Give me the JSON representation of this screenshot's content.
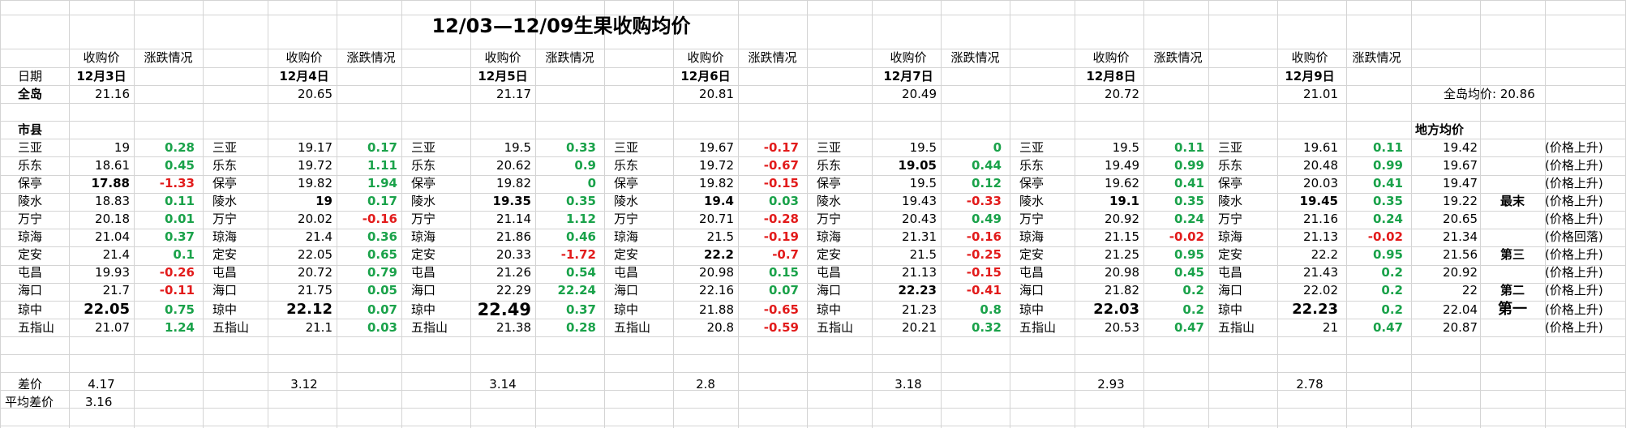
{
  "title": "12/03—12/09生果收购均价",
  "labels": {
    "date": "日期",
    "island": "全岛",
    "city_county": "市县",
    "spread": "差价",
    "avg_spread": "平均差价",
    "price_header": "收购价",
    "change_header": "涨跌情况",
    "island_avg": "全岛均价: 20.86",
    "local_avg": "地方均价"
  },
  "dates": [
    "12月3日",
    "12月4日",
    "12月5日",
    "12月6日",
    "12月7日",
    "12月8日",
    "12月9日"
  ],
  "island_prices": [
    "21.16",
    "20.65",
    "21.17",
    "20.81",
    "20.49",
    "20.72",
    "21.01"
  ],
  "spreads": [
    "4.17",
    "3.12",
    "3.14",
    "2.8",
    "3.18",
    "2.93",
    "2.78"
  ],
  "avg_spread": "3.16",
  "cities": [
    "三亚",
    "乐东",
    "保亭",
    "陵水",
    "万宁",
    "琼海",
    "定安",
    "屯昌",
    "海口",
    "琼中",
    "五指山"
  ],
  "days": [
    {
      "prices": [
        "19",
        "18.61",
        "17.88",
        "18.83",
        "20.18",
        "21.04",
        "21.4",
        "19.93",
        "21.7",
        "22.05",
        "21.07"
      ],
      "changes": [
        "0.28",
        "0.45",
        "-1.33",
        "0.11",
        "0.01",
        "0.37",
        "0.1",
        "-0.26",
        "-0.11",
        "0.75",
        "1.24"
      ],
      "bold_price": [
        false,
        false,
        true,
        false,
        false,
        false,
        false,
        false,
        false,
        true,
        false
      ],
      "big_price": [
        false,
        false,
        false,
        false,
        false,
        false,
        false,
        false,
        false,
        false,
        false
      ]
    },
    {
      "prices": [
        "19.17",
        "19.72",
        "19.82",
        "19",
        "20.02",
        "21.4",
        "22.05",
        "20.72",
        "21.75",
        "22.12",
        "21.1"
      ],
      "changes": [
        "0.17",
        "1.11",
        "1.94",
        "0.17",
        "-0.16",
        "0.36",
        "0.65",
        "0.79",
        "0.05",
        "0.07",
        "0.03"
      ],
      "bold_price": [
        false,
        false,
        false,
        true,
        false,
        false,
        false,
        false,
        false,
        true,
        false
      ],
      "big_price": [
        false,
        false,
        false,
        false,
        false,
        false,
        false,
        false,
        false,
        false,
        false
      ]
    },
    {
      "prices": [
        "19.5",
        "20.62",
        "19.82",
        "19.35",
        "21.14",
        "21.86",
        "20.33",
        "21.26",
        "22.29",
        "22.49",
        "21.38"
      ],
      "changes": [
        "0.33",
        "0.9",
        "0",
        "0.35",
        "1.12",
        "0.46",
        "-1.72",
        "0.54",
        "22.24",
        "0.37",
        "0.28"
      ],
      "bold_price": [
        false,
        false,
        false,
        true,
        false,
        false,
        false,
        false,
        false,
        true,
        false
      ],
      "big_price": [
        false,
        false,
        false,
        false,
        false,
        false,
        false,
        false,
        false,
        true,
        false
      ]
    },
    {
      "prices": [
        "19.67",
        "19.72",
        "19.82",
        "19.4",
        "20.71",
        "21.5",
        "22.2",
        "20.98",
        "22.16",
        "21.88",
        "20.8"
      ],
      "changes": [
        "-0.17",
        "-0.67",
        "-0.15",
        "0.03",
        "-0.28",
        "-0.19",
        "-0.7",
        "0.15",
        "0.07",
        "-0.65",
        "-0.59"
      ],
      "bold_price": [
        false,
        false,
        false,
        true,
        false,
        false,
        true,
        false,
        false,
        false,
        false
      ],
      "big_price": [
        false,
        false,
        false,
        false,
        false,
        false,
        false,
        false,
        false,
        false,
        false
      ]
    },
    {
      "prices": [
        "19.5",
        "19.05",
        "19.5",
        "19.43",
        "20.43",
        "21.31",
        "21.5",
        "21.13",
        "22.23",
        "21.23",
        "20.21"
      ],
      "changes": [
        "0",
        "0.44",
        "0.12",
        "-0.33",
        "0.49",
        "-0.16",
        "-0.25",
        "-0.15",
        "-0.41",
        "0.8",
        "0.32"
      ],
      "bold_price": [
        false,
        true,
        false,
        false,
        false,
        false,
        false,
        false,
        true,
        false,
        false
      ],
      "big_price": [
        false,
        false,
        false,
        false,
        false,
        false,
        false,
        false,
        false,
        false,
        false
      ]
    },
    {
      "prices": [
        "19.5",
        "19.49",
        "19.62",
        "19.1",
        "20.92",
        "21.15",
        "21.25",
        "20.98",
        "21.82",
        "22.03",
        "20.53"
      ],
      "changes": [
        "0.11",
        "0.99",
        "0.41",
        "0.35",
        "0.24",
        "-0.02",
        "0.95",
        "0.45",
        "0.2",
        "0.2",
        "0.47"
      ],
      "bold_price": [
        false,
        false,
        false,
        true,
        false,
        false,
        false,
        false,
        false,
        true,
        false
      ],
      "big_price": [
        false,
        false,
        false,
        false,
        false,
        false,
        false,
        false,
        false,
        false,
        false
      ]
    },
    {
      "prices": [
        "19.61",
        "20.48",
        "20.03",
        "19.45",
        "21.16",
        "21.13",
        "22.2",
        "21.43",
        "22.02",
        "22.23",
        "21"
      ],
      "changes": [
        "0.11",
        "0.99",
        "0.41",
        "0.35",
        "0.24",
        "-0.02",
        "0.95",
        "0.2",
        "0.2",
        "0.2",
        "0.47"
      ],
      "bold_price": [
        false,
        false,
        false,
        true,
        false,
        false,
        false,
        false,
        false,
        true,
        false
      ],
      "big_price": [
        false,
        false,
        false,
        false,
        false,
        false,
        false,
        false,
        false,
        false,
        false
      ]
    }
  ],
  "local_avgs": [
    "19.42",
    "19.67",
    "19.47",
    "19.22",
    "20.65",
    "21.34",
    "21.56",
    "20.92",
    "22",
    "22.04",
    "20.87"
  ],
  "ranks": [
    "",
    "",
    "",
    "最末",
    "",
    "",
    "第三",
    "",
    "第二",
    "第一",
    ""
  ],
  "trends": [
    "(价格上升)",
    "(价格上升)",
    "(价格上升)",
    "(价格上升)",
    "(价格上升)",
    "(价格回落)",
    "(价格上升)",
    "(价格上升)",
    "(价格上升)",
    "(价格上升)",
    "(价格上升)"
  ]
}
